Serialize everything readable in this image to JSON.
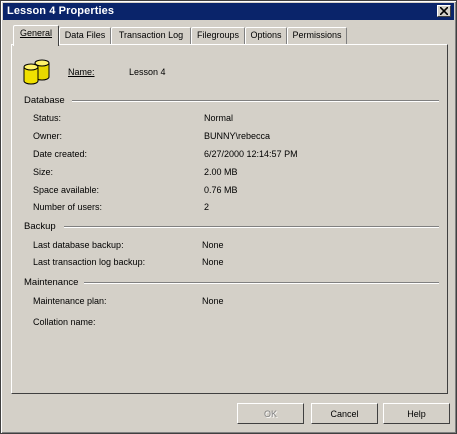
{
  "window": {
    "title": "Lesson 4 Properties"
  },
  "tabs": [
    {
      "label": "General",
      "active": true
    },
    {
      "label": "Data Files"
    },
    {
      "label": "Transaction Log"
    },
    {
      "label": "Filegroups"
    },
    {
      "label": "Options"
    },
    {
      "label": "Permissions"
    }
  ],
  "general": {
    "name_label": "Name:",
    "name_value": "Lesson 4",
    "icon": "database-cylinder-icon"
  },
  "database": {
    "title": "Database",
    "rows": [
      {
        "label": "Status:",
        "value": "Normal"
      },
      {
        "label": "Owner:",
        "value": "BUNNY\\rebecca"
      },
      {
        "label": "Date created:",
        "value": "6/27/2000 12:14:57 PM"
      },
      {
        "label": "Size:",
        "value": "2.00 MB"
      },
      {
        "label": "Space available:",
        "value": "0.76 MB"
      },
      {
        "label": "Number of users:",
        "value": "2"
      }
    ]
  },
  "backup": {
    "title": "Backup",
    "rows": [
      {
        "label": "Last database backup:",
        "value": "None"
      },
      {
        "label": "Last transaction log backup:",
        "value": "None"
      }
    ]
  },
  "maintenance": {
    "title": "Maintenance",
    "rows": [
      {
        "label": "Maintenance plan:",
        "value": "None"
      },
      {
        "label": "Collation name:",
        "value": ""
      }
    ]
  },
  "buttons": {
    "ok": "OK",
    "cancel": "Cancel",
    "help": "Help"
  },
  "colors": {
    "titlebar": "#0a246a",
    "face": "#d4d0c8",
    "icon_yellow": "#f0e000"
  }
}
